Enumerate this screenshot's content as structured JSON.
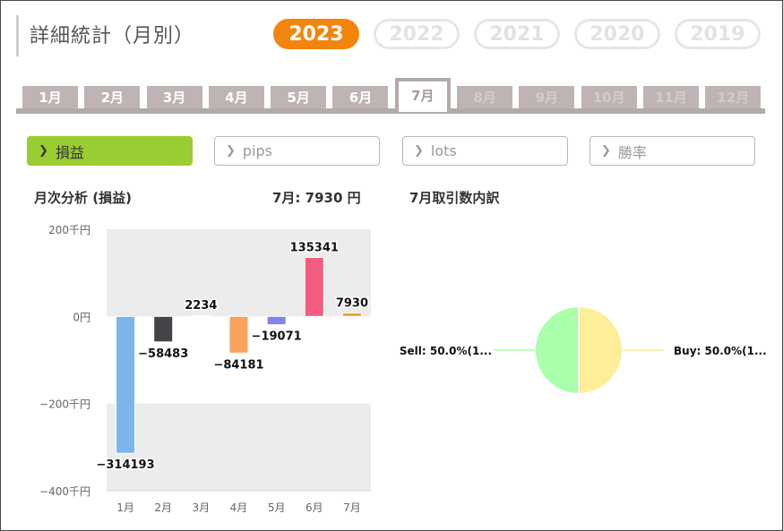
{
  "header": {
    "title": "詳細統計（月別）"
  },
  "years": [
    {
      "label": "2023",
      "active": true
    },
    {
      "label": "2022",
      "active": false
    },
    {
      "label": "2021",
      "active": false
    },
    {
      "label": "2020",
      "active": false
    },
    {
      "label": "2019",
      "active": false
    }
  ],
  "months": [
    {
      "label": "1月",
      "state": "normal"
    },
    {
      "label": "2月",
      "state": "normal"
    },
    {
      "label": "3月",
      "state": "normal"
    },
    {
      "label": "4月",
      "state": "normal"
    },
    {
      "label": "5月",
      "state": "normal"
    },
    {
      "label": "6月",
      "state": "normal"
    },
    {
      "label": "7月",
      "state": "active"
    },
    {
      "label": "8月",
      "state": "future"
    },
    {
      "label": "9月",
      "state": "future"
    },
    {
      "label": "10月",
      "state": "future"
    },
    {
      "label": "11月",
      "state": "future"
    },
    {
      "label": "12月",
      "state": "future"
    }
  ],
  "metrics": [
    {
      "label": "損益",
      "active": true
    },
    {
      "label": "pips",
      "active": false
    },
    {
      "label": "lots",
      "active": false
    },
    {
      "label": "勝率",
      "active": false
    }
  ],
  "monthly_analysis": {
    "title": "月次分析 (損益)",
    "summary": "7月:  7930 円"
  },
  "trade_breakdown": {
    "title": "7月取引数内訳"
  },
  "chart_data": [
    {
      "type": "bar",
      "categories": [
        "1月",
        "2月",
        "3月",
        "4月",
        "5月",
        "6月",
        "7月"
      ],
      "values": [
        -314193,
        -58483,
        2234,
        -84181,
        -19071,
        135341,
        7930
      ],
      "value_labels": [
        "−314193",
        "−58483",
        "2234",
        "−84181",
        "−19071",
        "135341",
        "7930"
      ],
      "colors": [
        "#7cb5ec",
        "#434348",
        "#eeeeee",
        "#f7a35c",
        "#8085e9",
        "#f15c80",
        "#f0a030"
      ],
      "ylim": [
        -400000,
        200000
      ],
      "yticks": [
        {
          "value": 200000,
          "label": "200千円"
        },
        {
          "value": 0,
          "label": "0円"
        },
        {
          "value": -200000,
          "label": "−200千円"
        },
        {
          "value": -400000,
          "label": "−400千円"
        }
      ],
      "band_color": "#ececec"
    },
    {
      "type": "pie",
      "slices": [
        {
          "name": "Sell",
          "value": 50.0,
          "label": "Sell: 50.0%(1...",
          "color": "#aaffaa"
        },
        {
          "name": "Buy",
          "value": 50.0,
          "label": "Buy: 50.0%(1...",
          "color": "#ffee99"
        }
      ]
    }
  ]
}
